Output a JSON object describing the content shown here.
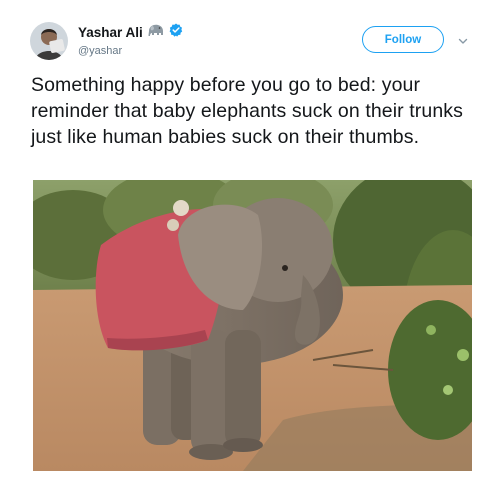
{
  "user": {
    "display_name": "Yashar Ali",
    "name_emoji": "elephant-emoji",
    "verified": true,
    "handle": "@yashar"
  },
  "follow_button": {
    "label": "Follow"
  },
  "more_menu_icon": "chevron-down-icon",
  "tweet": {
    "text": "Something happy before you go to bed: your reminder that baby elephants suck on their trunks just like human babies suck on their thumbs."
  },
  "media": {
    "subject": "baby-elephant-photo"
  },
  "colors": {
    "accent": "#1da1f2",
    "text": "#14171a",
    "secondary_text": "#657786"
  }
}
